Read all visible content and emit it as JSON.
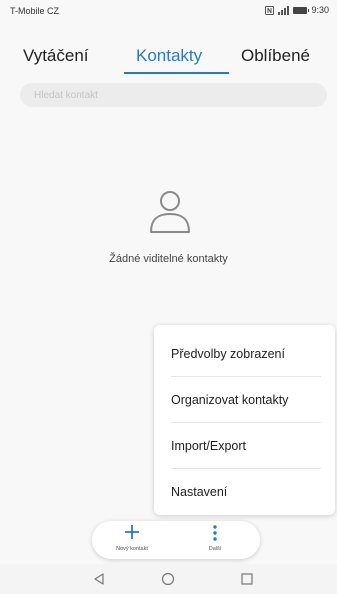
{
  "status_bar": {
    "carrier": "T-Mobile CZ",
    "time": "9:30"
  },
  "tabs": [
    {
      "label": "Vytáčení"
    },
    {
      "label": "Kontakty"
    },
    {
      "label": "Oblíbené"
    }
  ],
  "active_tab": "Kontakty",
  "search": {
    "placeholder": "Hledat kontakt",
    "value": ""
  },
  "empty_state": {
    "icon": "person-icon",
    "text": "Žádné viditelné kontakty"
  },
  "menu": {
    "items": [
      {
        "label": "Předvolby zobrazení"
      },
      {
        "label": "Organizovat kontakty"
      },
      {
        "label": "Import/Export"
      },
      {
        "label": "Nastavení"
      }
    ]
  },
  "bottom_actions": [
    {
      "label": "Nový kontakt",
      "icon": "plus-icon"
    },
    {
      "label": "Další",
      "icon": "more-vertical-icon"
    }
  ],
  "navigation": [
    {
      "icon": "back-triangle-icon"
    },
    {
      "icon": "home-circle-icon"
    },
    {
      "icon": "recents-square-icon"
    }
  ],
  "colors": {
    "accent": "#1f7bd7",
    "background": "#f8f8f8",
    "menu_background": "#ffffff"
  }
}
